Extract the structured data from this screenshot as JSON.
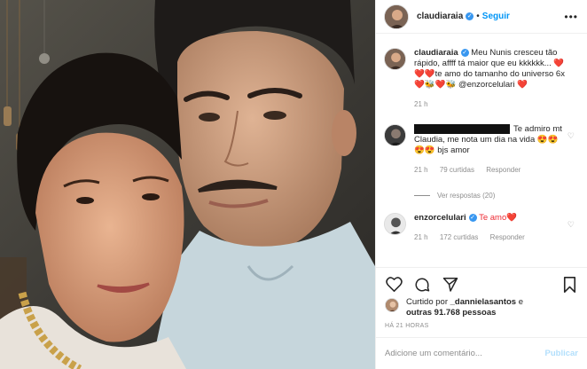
{
  "post": {
    "username": "claudiaraia",
    "follow_label": "Seguir",
    "more_label": "•••"
  },
  "caption": {
    "username": "claudiaraia",
    "text": "Meu Nunis cresceu tão rápido, affff tá maior que eu kkkkkk... ❤️❤️❤️te amo do tamanho do universo 6x ❤️🐝❤️🐝 @enzorcelulari ❤️",
    "time": "21 h"
  },
  "comment1": {
    "text": "Te admiro mt Claudia, me nota um dia na vida 😍😍😍😍 bjs amor",
    "time": "21 h",
    "likes": "79 curtidas",
    "reply": "Responder",
    "view_replies": "Ver respostas (20)"
  },
  "comment2": {
    "username": "enzorcelulari",
    "text": "Te amo❤️",
    "time": "21 h",
    "likes": "172 curtidas",
    "reply": "Responder"
  },
  "likes_summary": {
    "prefix": "Curtido por",
    "user": "_dannielasantos",
    "middle": "e",
    "others": "outras 91.768 pessoas"
  },
  "timestamp": "HÁ 21 HORAS",
  "add_comment": {
    "placeholder": "Adicione um comentário...",
    "publish_label": "Publicar"
  },
  "colors": {
    "link_blue": "#0095f6",
    "muted": "#8e8e8e",
    "heart_red": "#ed2a33"
  }
}
